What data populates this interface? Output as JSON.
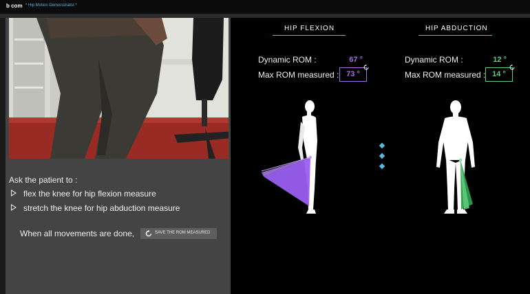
{
  "window": {
    "logo": "b com",
    "title": "* Hip Motion Demonstrator *"
  },
  "instructions": {
    "intro": "Ask the patient to :",
    "items": [
      "flex the knee for hip flexion measure",
      "stretch the knee for hip abduction measure"
    ],
    "done_text": "When all movements are done,",
    "save_button": "SAVE THE ROM MEASURED"
  },
  "flexion": {
    "title": "HIP FLEXION",
    "dynamic_label": "Dynamic ROM :",
    "dynamic_value": "67 °",
    "max_label": "Max ROM measured :",
    "max_value": "73 °",
    "color": "#a96be8"
  },
  "abduction": {
    "title": "HIP ABDUCTION",
    "dynamic_label": "Dynamic ROM :",
    "dynamic_value": "12 °",
    "max_label": "Max ROM measured :",
    "max_value": "14 °",
    "color": "#5fcf82"
  },
  "colors": {
    "accent": "#5ab7e0"
  },
  "icons": {
    "reset": "reset-icon",
    "bullet": "play-triangle-icon",
    "save": "refresh-icon",
    "carousel": "diamond-indicator-icon"
  }
}
